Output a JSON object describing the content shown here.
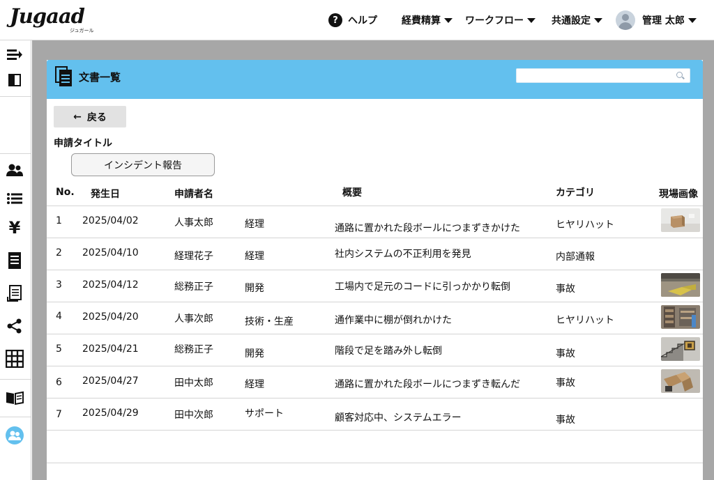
{
  "header": {
    "logo_text": "Jugaad",
    "logo_sub": "ジュガール",
    "help": "ヘルプ",
    "menu_expense": "経費精算",
    "menu_workflow": "ワークフロー",
    "menu_common": "共通設定",
    "user_name": "管理 太郎"
  },
  "sidebar": {
    "icons": [
      "menu-collapse-icon",
      "panel-icon",
      "users-icon",
      "list-icon",
      "yen-icon",
      "document-icon",
      "receipt-icon",
      "share-icon",
      "grid-icon",
      "book-icon",
      "group-icon"
    ]
  },
  "panel": {
    "title": "文書一覧",
    "search_placeholder": "",
    "back_label": "戻る",
    "field_label": "申請タイトル",
    "field_value": "インシデント報告"
  },
  "table": {
    "columns": {
      "no": "No.",
      "date": "発生日",
      "applicant": "申請者名",
      "summary": "概要",
      "category": "カテゴリ",
      "photo": "現場画像"
    },
    "rows": [
      {
        "no": "1",
        "date": "2025/04/02",
        "applicant": "人事太郎",
        "dept": "経理",
        "summary": "通路に置かれた段ボールにつまずきかけた",
        "category": "ヒヤリハット",
        "photo": "boxes"
      },
      {
        "no": "2",
        "date": "2025/04/10",
        "applicant": "経理花子",
        "dept": "経理",
        "summary": "社内システムの不正利用を発見",
        "category": "内部通報",
        "photo": ""
      },
      {
        "no": "3",
        "date": "2025/04/12",
        "applicant": "総務正子",
        "dept": "開発",
        "summary": "工場内で足元のコードに引っかかり転倒",
        "category": "事故",
        "photo": "floor"
      },
      {
        "no": "4",
        "date": "2025/04/20",
        "applicant": "人事次郎",
        "dept": "技術・生産",
        "summary": "通作業中に棚が倒れかけた",
        "category": "ヒヤリハット",
        "photo": "shelf"
      },
      {
        "no": "5",
        "date": "2025/04/21",
        "applicant": "総務正子",
        "dept": "開発",
        "summary": "階段で足を踏み外し転倒",
        "category": "事故",
        "photo": "stairs"
      },
      {
        "no": "6",
        "date": "2025/04/27",
        "applicant": "田中太郎",
        "dept": "経理",
        "summary": "通路に置かれた段ボールにつまずき転んだ",
        "category": "事故",
        "photo": "fallen-boxes"
      },
      {
        "no": "7",
        "date": "2025/04/29",
        "applicant": "田中次郎",
        "dept": "サポート",
        "summary": "顧客対応中、システムエラー",
        "category": "事故",
        "photo": ""
      }
    ]
  }
}
